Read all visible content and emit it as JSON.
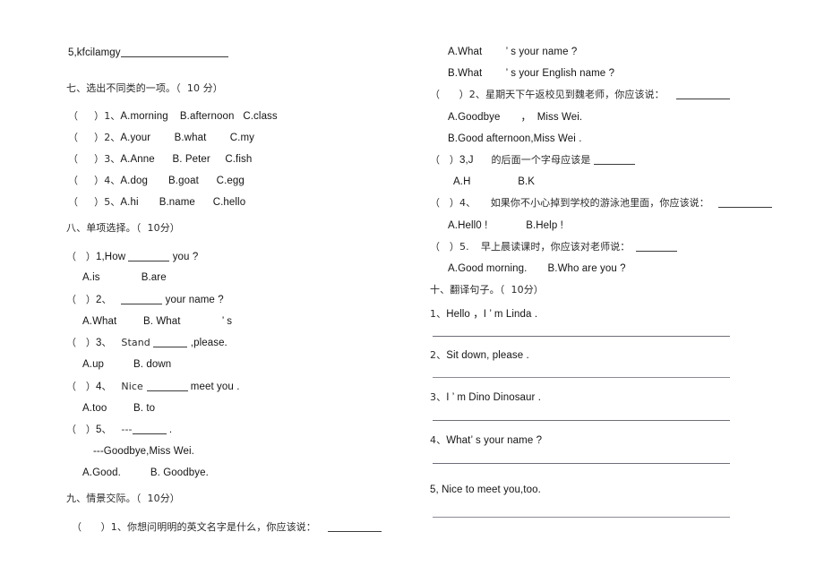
{
  "document": {
    "type": "exam-paper",
    "language": "zh-CN/en",
    "page_background": "#ffffff",
    "text_color": "#141414"
  },
  "left_column": {
    "orphan_item": {
      "number": "5,",
      "word": "kfcilamgy"
    },
    "section_seven": {
      "heading": "七、选出不同类的一项。（  10 分）",
      "items": [
        {
          "paren": "（     ）",
          "number": "1、",
          "a": "A.morning",
          "b": "B.afternoon",
          "c": "C.class"
        },
        {
          "paren": "（     ）",
          "number": "2、",
          "a": "A.your",
          "b": "B.what",
          "c": "C.my"
        },
        {
          "paren": "（     ）",
          "number": "3、",
          "a": "A.Anne",
          "b": "B. Peter",
          "c": "C.fish"
        },
        {
          "paren": "（     ）",
          "number": "4、",
          "a": "A.dog",
          "b": "B.goat",
          "c": "C.egg"
        },
        {
          "paren": "（     ）",
          "number": "5、",
          "a": "A.hi",
          "b": "B.name",
          "c": "C.hello"
        }
      ]
    },
    "section_eight": {
      "heading": "八、单项选择。（  10分）",
      "items": [
        {
          "paren": "（   ）",
          "number": "1,",
          "stem_before": "How ",
          "stem_after": " you ?",
          "options": "A.is              B.are"
        },
        {
          "paren": "（   ）",
          "number": "2",
          "stem_before": "、   ",
          "stem_after": " your name ?",
          "options": "A.What         B. What              ’ s"
        },
        {
          "paren": "（   ）",
          "number": "3",
          "stem_before": "、   Stand ",
          "stem_after": " ,please.",
          "options": "A.up          B. down"
        },
        {
          "paren": "（   ）",
          "number": "4",
          "stem_before": "、   Nice ",
          "stem_after": " meet you .",
          "options": "A.too         B. to"
        },
        {
          "paren": "（   ）",
          "number": "5",
          "stem_before": "、   ---",
          "stem_after": " .",
          "second_line": "---Goodbye,Miss Wei.",
          "options": "A.Good.          B. Goodbye."
        }
      ]
    },
    "section_nine": {
      "heading": "九、情景交际。（  10分）",
      "item1": {
        "paren": "（      ）",
        "number": "1、",
        "prompt": "你想问明明的英文名字是什么，你应该说："
      }
    }
  },
  "right_column": {
    "section_nine_continued": {
      "item1_options": [
        "A.What        ’ s your name ?",
        "B.What        ’ s your English name ?"
      ],
      "items": [
        {
          "paren": "（      ）",
          "number": "2、",
          "prompt": "星期天下午返校见到魏老师，你应该说：",
          "options": [
            "A.Goodbye       ，  Miss Wei.",
            "B.Good afternoon,Miss Wei ."
          ]
        },
        {
          "paren": "（   ）",
          "number": "3,J",
          "prompt": "的后面一个字母应该是",
          "options": [
            "A.H                B.K"
          ]
        },
        {
          "paren": "（   ）",
          "number": "4、",
          "prompt": "如果你不小心掉到学校的游泳池里面，你应该说：",
          "options": [
            "A.Hell0 !             B.Help !"
          ]
        },
        {
          "paren": "（   ）",
          "number": "5.",
          "prompt": "早上晨读课时，你应该对老师说：",
          "options": [
            "A.Good morning.       B.Who are you ?"
          ]
        }
      ]
    },
    "section_ten": {
      "heading": "十、翻译句子。（  10分）",
      "items": [
        {
          "number": "1、",
          "sentence": "Hello ，I ’ m Linda ."
        },
        {
          "number": "2、",
          "sentence": "Sit down, please ."
        },
        {
          "number": "3、",
          "sentence": "I ’ m Dino Dinosaur ."
        },
        {
          "number": "4、",
          "sentence": "What’ s your name ?"
        },
        {
          "number": "5,",
          "sentence": "Nice to meet you,too."
        }
      ]
    }
  }
}
